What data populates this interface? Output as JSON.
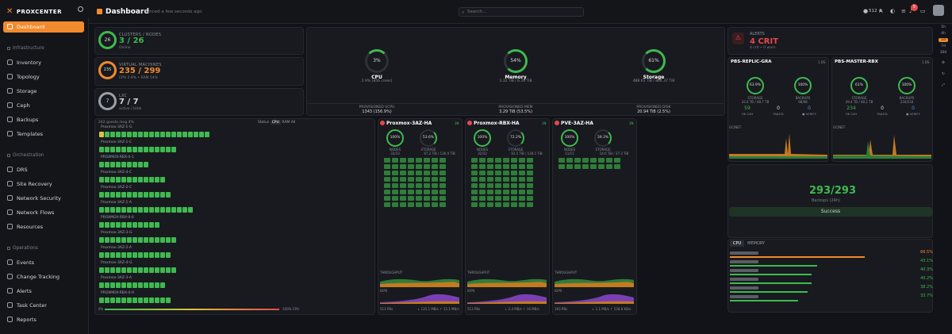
{
  "app": {
    "brand": "PROXCENTER",
    "title": "Dashboard",
    "synced": "· Synced a few seconds ago"
  },
  "search": {
    "placeholder": "Search..."
  },
  "topbar": {
    "github_stars": "512 ★",
    "notifications": "5"
  },
  "sidebar": {
    "active": "Dashboard",
    "sections": [
      {
        "title": "Infrastructure",
        "items": [
          "Inventory",
          "Topology",
          "Storage",
          "Ceph",
          "Backups",
          "Templates"
        ]
      },
      {
        "title": "Orchestration",
        "items": [
          "DRS",
          "Site Recovery",
          "Network Security",
          "Network Flows",
          "Resources"
        ]
      },
      {
        "title": "Operations",
        "items": [
          "Events",
          "Change Tracking",
          "Alerts",
          "Task Center",
          "Reports"
        ]
      }
    ]
  },
  "time_ranges": [
    "1h",
    "4h",
    "1d",
    "7d",
    "30d"
  ],
  "summary": {
    "clusters": {
      "title": "CLUSTERS / NODES",
      "ring": "26",
      "value": "3 / 26",
      "sub": "Online"
    },
    "vms": {
      "title": "VIRTUAL MACHINES",
      "ring": "235",
      "value": "235 / 299",
      "sub": "CPU 2.9% • RAM 54%"
    },
    "lxc": {
      "title": "LXC",
      "ring": "7",
      "value": "7 / 7",
      "sub": "active / total"
    }
  },
  "resources": {
    "cpu": {
      "label": "CPU",
      "pct": "3%",
      "sub": "2.9% (856 cores)",
      "prov_title": "PROVISIONED VCPU",
      "prov_value": "1343 (156.9%)"
    },
    "memory": {
      "label": "Memory",
      "pct": "54%",
      "sub": "3.32 TiB / 6.16 TiB",
      "prov_title": "PROVISIONED MEM",
      "prov_value": "3.29 TiB (53.5%)"
    },
    "storage": {
      "label": "Storage",
      "pct": "61%",
      "sub": "488.65 TiB / 804.37 TiB",
      "prov_title": "PROVISIONED DISK",
      "prov_value": "20.94 TiB (2.5%)"
    }
  },
  "heatmap": {
    "header": "242 guests /avg 4%",
    "controls": [
      "Status",
      "CPU",
      "RAM",
      "All"
    ],
    "rows": [
      "Proxmox-3AZ-1-G",
      "Proxmox-3AZ-1-C",
      "PROXMOX-RBX-0-1",
      "Proxmox-3AZ-4-C",
      "Proxmox-3AZ-2-C",
      "Proxmox-3AZ-1-A",
      "PROXMOX-RBX-0-6",
      "Proxmox-3AZ-3-G",
      "Proxmox-3AZ-2-A",
      "Proxmox-3AZ-4-G",
      "Proxmox-3AZ-3-A",
      "PROXMOX-RBX-0-9"
    ],
    "legend_left": "0%",
    "legend_right": "100% CPU"
  },
  "clusters": [
    {
      "name": "Proxmox-3AZ-HA",
      "tag": "3N",
      "r1": "100%",
      "r2": "53.6%",
      "l1": "NODES",
      "l2": "STORAGE",
      "s1": "33/33",
      "s2": "67.2 TiB / 126.0 TiB",
      "throughput": "THROUGHPUT",
      "iops": "IOPS",
      "footer_l": "513 PBs",
      "footer_r": "↓ 135.1 MB/s ↑ 15.1 MB/s"
    },
    {
      "name": "Proxmox-RBX-HA",
      "tag": "3N",
      "r1": "100%",
      "r2": "72.2%",
      "l1": "NODES",
      "l2": "STORAGE",
      "s1": "32/32",
      "s2": "92.5 TiB / 128.1 TiB",
      "throughput": "THROUGHPUT",
      "iops": "IOPS",
      "footer_l": "513 PBs",
      "footer_r": "↓ 2.4 MB/s ↑ 16 MB/s"
    },
    {
      "name": "PVE-3AZ-HA",
      "tag": "3N",
      "r1": "100%",
      "r2": "39.3%",
      "l1": "NODES",
      "l2": "STORAGE",
      "s1": "11/11",
      "s2": "14.6 TiB / 37.3 TiB",
      "throughput": "THROUGHPUT",
      "iops": "IOPS",
      "footer_l": "193 PBs",
      "footer_r": "↓ 1.1 MB/s ↑ 528.8 KB/s"
    }
  ],
  "alerts": {
    "title": "ALERTS",
    "value": "4 CRIT",
    "sub": "4 crit • 0 warn"
  },
  "pbs": [
    {
      "name": "PBS-REPLIC-GRA",
      "tag": "1 DS",
      "r1": "63.9%",
      "r2": "100%",
      "l1": "STORAGE",
      "l2": "BACKUPS",
      "s1": "32.6 TB / 48.7 TB",
      "s2": "98/98",
      "n1": "59",
      "n2": "0",
      "n3": "0",
      "k1": "OK 24H",
      "k2": "FAILED",
      "k3": "● VERIFY",
      "chart": "GC/NET"
    },
    {
      "name": "PBS-MASTER-RBX",
      "tag": "1 DS",
      "r1": "61%",
      "r2": "100%",
      "l1": "STORAGE",
      "l2": "BACKUPS",
      "s1": "29.4 TB / 48.2 TB",
      "s2": "234/234",
      "n1": "234",
      "n2": "0",
      "n3": "0",
      "k1": "OK 24H",
      "k2": "FAILED",
      "k3": "● VERIFY",
      "chart": "GC/NET"
    }
  ],
  "backups": {
    "value": "293/293",
    "sub": "Backups (24h)",
    "status": "Success"
  },
  "top": {
    "tabs": [
      "CPU",
      "MEMORY"
    ],
    "rows": [
      {
        "pct": "66.5%",
        "fill": 0.665,
        "color": "#f28a2e"
      },
      {
        "pct": "43.1%",
        "fill": 0.431,
        "color": "#3fb950"
      },
      {
        "pct": "40.3%",
        "fill": 0.403,
        "color": "#3fb950"
      },
      {
        "pct": "40.2%",
        "fill": 0.402,
        "color": "#3fb950"
      },
      {
        "pct": "38.2%",
        "fill": 0.382,
        "color": "#3fb950"
      },
      {
        "pct": "33.7%",
        "fill": 0.337,
        "color": "#3fb950"
      }
    ]
  }
}
